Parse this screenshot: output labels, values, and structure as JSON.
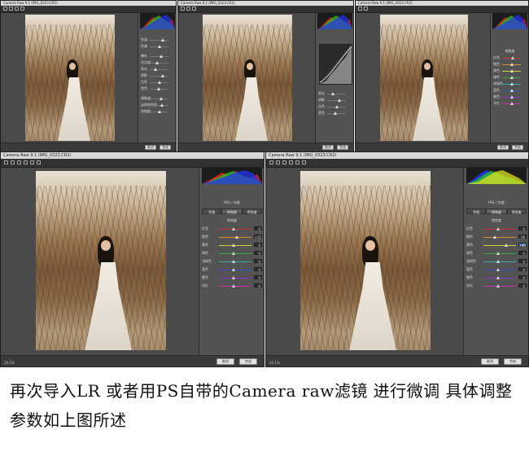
{
  "windows": [
    {
      "id": "top-1",
      "title": "Camera Raw 9.1 (IMG_0323.CR2)"
    },
    {
      "id": "top-2",
      "title": "Camera Raw 9.1 (IMG_0323.CR2)"
    },
    {
      "id": "top-3",
      "title": "Camera Raw 9.1 (IMG_0323.CR2)"
    },
    {
      "id": "bottom-1",
      "title": "Camera Raw 9.1 (IMG_0323.CR2)"
    },
    {
      "id": "bottom-2",
      "title": "Camera Raw 9.1 (IMG_0323.CR2)"
    }
  ],
  "hsl": {
    "tabs": [
      "色相",
      "饱和度",
      "明亮度"
    ],
    "section_label": "饱和度",
    "header": "HSL / 灰度",
    "labels": [
      "红色",
      "橙色",
      "黄色",
      "绿色",
      "浅绿色",
      "蓝色",
      "紫色",
      "洋红"
    ],
    "values_a": [
      "0",
      "+15",
      "0",
      "0",
      "0",
      "0",
      "0",
      "0"
    ],
    "values_b": [
      "0",
      "-16",
      "+40",
      "0",
      "0",
      "0",
      "0",
      "0"
    ]
  },
  "basic": {
    "labels": [
      "色温",
      "色调",
      "曝光",
      "对比度",
      "高光",
      "阴影",
      "白色",
      "黑色",
      "清晰度",
      "自然饱和度",
      "饱和度"
    ]
  },
  "buttons": {
    "cancel": "取消",
    "done": "完成"
  },
  "zoom": "24.1%",
  "caption": "再次导入LR 或者用PS自带的Camera raw滤镜 进行微调 具体调整参数如上图所述"
}
